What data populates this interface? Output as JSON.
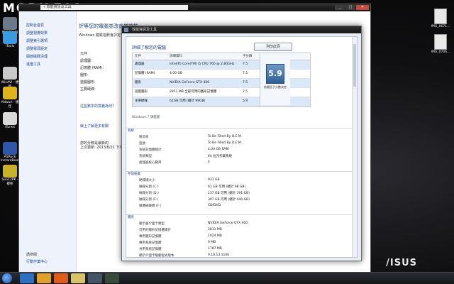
{
  "watermark": {
    "logo": "MOBILE01",
    "sub": "",
    "post_id": "#1906693"
  },
  "desktop": {
    "brand": "/ISUS",
    "left_icons": [
      {
        "label": "資源回收筒",
        "icon": "recycle-bin-icon",
        "color": "#6b7a8a"
      },
      {
        "label": "iTools",
        "icon": "itools-icon",
        "color": "#3b9be0"
      },
      {
        "label": "WinAVI - 捷徑",
        "icon": "winavi-icon",
        "color": "#c9c9c9"
      },
      {
        "label": "ANworl - 捷徑",
        "icon": "anworl-icon",
        "color": "#e0b21c"
      },
      {
        "label": "iTunes",
        "icon": "itunes-icon",
        "color": "#d9d9d9"
      },
      {
        "label": "ASRock InstantBoot",
        "icon": "asrock-icon",
        "color": "#2f57a8"
      },
      {
        "label": "Sun12PK - 捷徑",
        "icon": "sun12pk-icon",
        "color": "#c8b22a"
      }
    ],
    "right_icons": [
      {
        "label": "IMG_0671...",
        "icon": "image-file-icon"
      },
      {
        "label": "IMG_0706...",
        "icon": "image-file-icon"
      }
    ]
  },
  "explorer": {
    "breadcrumb": "« 效能資訊及工具",
    "left_nav": [
      "控制台首頁",
      "調整視覺效果",
      "調整索引選項",
      "調整電源設定",
      "開啟磁碟清理",
      "進階工具"
    ],
    "see_also": "請參閱",
    "bottom_link": "行動作業中心",
    "heading": "評等您的電腦並改善其效能",
    "subtext": "Windows 體驗指數會評定您的電腦...",
    "section_label": "元件",
    "rows": [
      "處理器:",
      "記憶體 (RAM):",
      "圖形:",
      "遊戲圖形:",
      "主要硬碟:"
    ],
    "links": [
      "這些數字的意義為何?",
      "線上了解更多有關"
    ],
    "last_update_label": "您的分數是最新的",
    "last_update": "上次更新: 2013/8/21 下午 03:..."
  },
  "dialog": {
    "title": "效能資訊及工具",
    "heading": "詳細了解您的電腦",
    "print_label": "列印此頁",
    "columns": [
      "元件",
      "詳細資料",
      "子分數",
      "基本分數"
    ],
    "scores": [
      {
        "component": "處理器",
        "detail": "Intel(R) Core(TM) i5 CPU 760 @ 2.80GHz",
        "score": "7.5"
      },
      {
        "component": "記憶體 (RAM)",
        "detail": "4.00 GB",
        "score": "7.5"
      },
      {
        "component": "圖形",
        "detail": "NVIDIA GeForce GTX 460",
        "score": "7.5"
      },
      {
        "component": "遊戲圖形",
        "detail": "2811 MB 全部可用的圖形記憶體",
        "score": "7.5"
      },
      {
        "component": "主要硬碟",
        "detail": "61GB 可用 (總計 99GB)",
        "score": "5.9"
      }
    ],
    "base_score": "5.9",
    "base_caption": "依最低子分數決定",
    "edition": "Windows 7 旗艦版",
    "sections": [
      {
        "title": "系統",
        "items": [
          {
            "k": "製造商",
            "v": "To Be Filled By O.E.M."
          },
          {
            "k": "型號",
            "v": "To Be Filled By O.E.M."
          },
          {
            "k": "系統記憶體總計",
            "v": "4.00 GB RAM"
          },
          {
            "k": "系統類型",
            "v": "64 位元作業系統"
          },
          {
            "k": "處理器核心數目",
            "v": "4"
          }
        ]
      },
      {
        "title": "存放裝置",
        "items": [
          {
            "k": "硬碟總大小",
            "v": "931 GB"
          },
          {
            "k": "磁碟分割 (C:)",
            "v": "61 GB 可用 (總計 98 GB)"
          },
          {
            "k": "磁碟分割 (D:)",
            "v": "137 GB 可用 (總計 391 GB)"
          },
          {
            "k": "磁碟分割 (E:)",
            "v": "397 GB 可用 (總計 440 GB)"
          },
          {
            "k": "媒體磁碟機 (F:)",
            "v": "CD/DVD"
          }
        ]
      },
      {
        "title": "圖形",
        "items": [
          {
            "k": "顯示器介面卡類型",
            "v": "NVIDIA GeForce GTX 460"
          },
          {
            "k": "可用的圖形記憶體總計",
            "v": "2811 MB"
          },
          {
            "k": "專用圖形記憶體",
            "v": "1024 MB"
          },
          {
            "k": "專用系統記憶體",
            "v": "0 MB"
          },
          {
            "k": "共用系統記憶體",
            "v": "1787 MB"
          },
          {
            "k": "顯示介面卡驅動程式版本",
            "v": "9.18.13.1106"
          },
          {
            "k": "主要監視器解析度",
            "v": "1680x1050"
          },
          {
            "k": "DirectX 版本",
            "v": "DirectX 10"
          }
        ]
      }
    ]
  }
}
